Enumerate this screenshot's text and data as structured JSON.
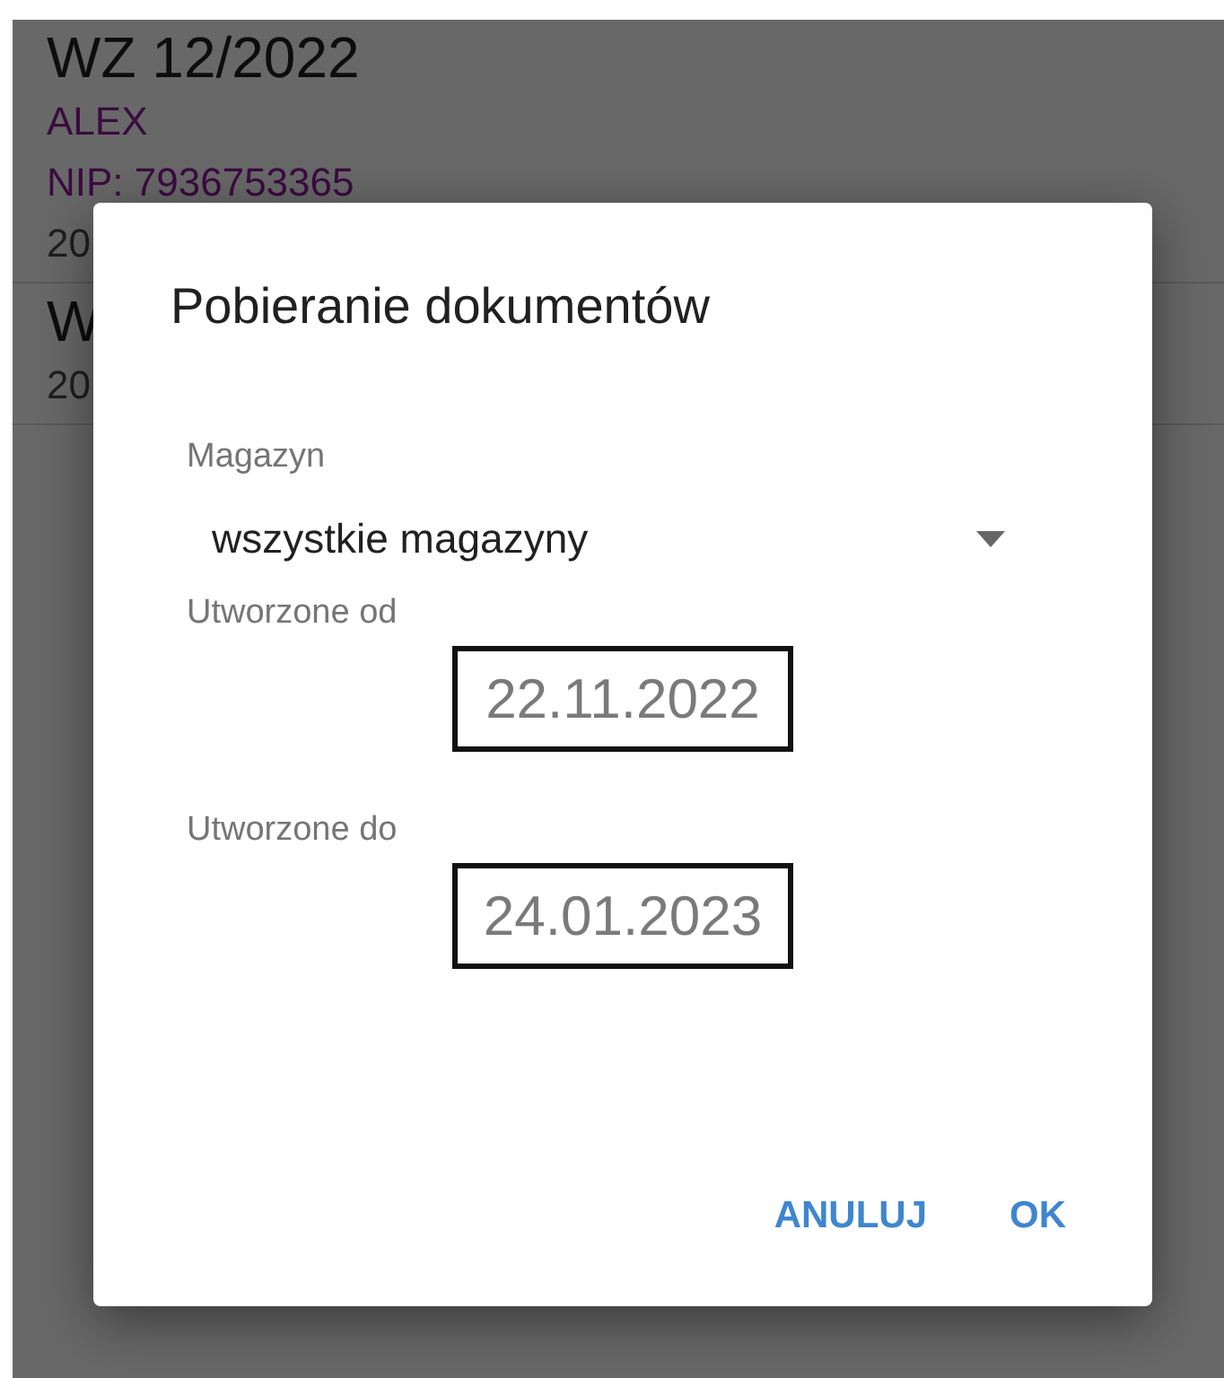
{
  "background_list": [
    {
      "title": "WZ 12/2022",
      "customer": "ALEX",
      "nip": "NIP: 7936753365",
      "date": "20"
    },
    {
      "title": "W",
      "date": "20"
    }
  ],
  "dialog": {
    "title": "Pobieranie dokumentów",
    "fields": [
      {
        "kind": "dropdown",
        "label": "Magazyn",
        "value": "wszystkie magazyny"
      },
      {
        "kind": "date",
        "label": "Utworzone od",
        "value": "22.11.2022"
      },
      {
        "kind": "date",
        "label": "Utworzone do",
        "value": "24.01.2023"
      }
    ],
    "buttons": [
      "ANULUJ",
      "OK"
    ]
  }
}
